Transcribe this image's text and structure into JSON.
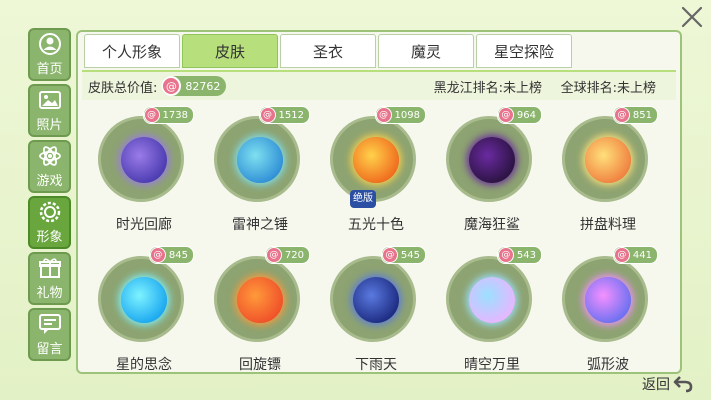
{
  "sidebar": {
    "items": [
      {
        "label": "首页",
        "icon": "user-icon"
      },
      {
        "label": "照片",
        "icon": "photo-icon"
      },
      {
        "label": "游戏",
        "icon": "atom-icon"
      },
      {
        "label": "形象",
        "icon": "gear-icon",
        "active": true
      },
      {
        "label": "礼物",
        "icon": "gift-icon"
      },
      {
        "label": "留言",
        "icon": "message-icon"
      }
    ]
  },
  "tabs": [
    {
      "label": "个人形象"
    },
    {
      "label": "皮肤",
      "active": true
    },
    {
      "label": "圣衣"
    },
    {
      "label": "魔灵"
    },
    {
      "label": "星空探险"
    }
  ],
  "info": {
    "total_label": "皮肤总价值:",
    "total_value": "82762",
    "province_rank": "黑龙江排名:未上榜",
    "global_rank": "全球排名:未上榜"
  },
  "skins": [
    {
      "name": "时光回廊",
      "price": "1738",
      "colors": [
        "#9a7be8",
        "#4a3bb0"
      ]
    },
    {
      "name": "雷神之锤",
      "price": "1512",
      "colors": [
        "#7fe0f0",
        "#2f8fd6"
      ]
    },
    {
      "name": "五光十色",
      "price": "1098",
      "colors": [
        "#ffd24a",
        "#f06a1e"
      ],
      "badge": "绝版"
    },
    {
      "name": "魔海狂鲨",
      "price": "964",
      "colors": [
        "#6a2aa0",
        "#2a1340"
      ]
    },
    {
      "name": "拼盘料理",
      "price": "851",
      "colors": [
        "#ffe07a",
        "#f08040"
      ]
    },
    {
      "name": "星的思念",
      "price": "845",
      "colors": [
        "#7ef3ff",
        "#1aa7f0"
      ]
    },
    {
      "name": "回旋镖",
      "price": "720",
      "colors": [
        "#ff9a3a",
        "#f0502a"
      ]
    },
    {
      "name": "下雨天",
      "price": "545",
      "colors": [
        "#5a7ae0",
        "#1c2a80"
      ]
    },
    {
      "name": "晴空万里",
      "price": "543",
      "colors": [
        "#9be0ff",
        "#e8b6ff"
      ]
    },
    {
      "name": "弧形波",
      "price": "441",
      "colors": [
        "#f590ff",
        "#6a70f0"
      ]
    }
  ],
  "back_label": "返回"
}
